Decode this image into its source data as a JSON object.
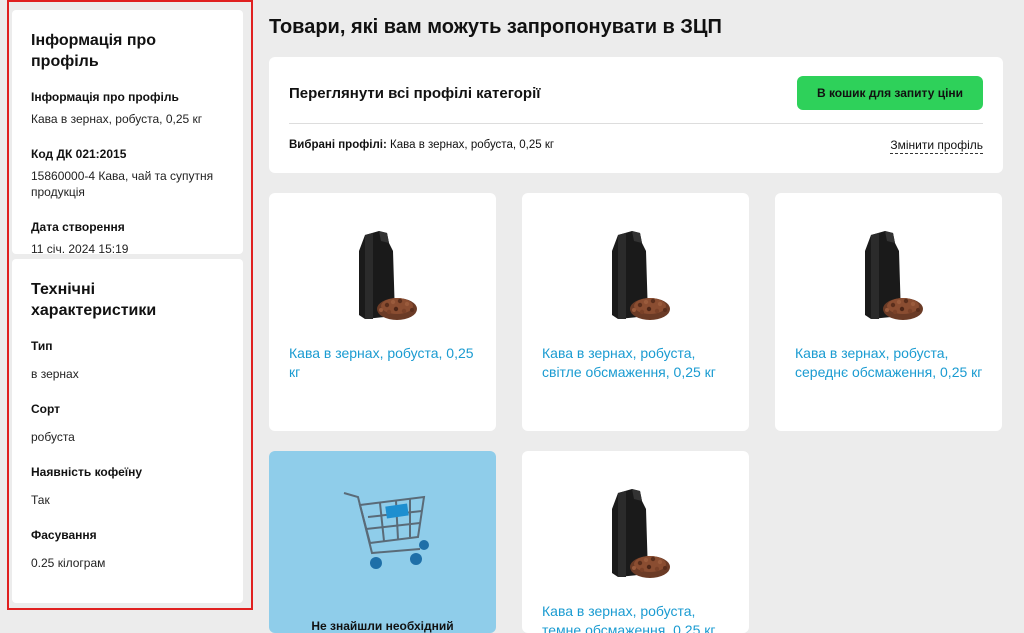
{
  "sidebar": {
    "profile": {
      "heading": "Інформація про профіль",
      "fields": [
        {
          "label": "Інформація про профіль",
          "value": "Кава в зернах, робуста, 0,25 кг"
        },
        {
          "label": "Код ДК 021:2015",
          "value": "15860000-4 Кава, чай та супутня продукція"
        },
        {
          "label": "Дата створення",
          "value": "11 січ. 2024 15:19"
        }
      ]
    },
    "tech": {
      "heading": "Технічні характеристики",
      "fields": [
        {
          "label": "Тип",
          "value": "в зернах"
        },
        {
          "label": "Сорт",
          "value": "робуста"
        },
        {
          "label": "Наявність кофеїну",
          "value": "Так"
        },
        {
          "label": "Фасування",
          "value": "0.25 кілограм"
        }
      ]
    }
  },
  "main": {
    "title": "Товари, які вам можуть запропонувати в ЗЦП",
    "panel": {
      "view_all": "Переглянути всі профілі категорії",
      "cart_button": "В кошик для запиту ціни",
      "selected_label": "Вибрані профілі:",
      "selected_value": " Кава в зернах, робуста, 0,25 кг",
      "change_link": "Змінити профіль"
    },
    "products": [
      {
        "title": "Кава в зернах, робуста, 0,25 кг"
      },
      {
        "title": "Кава в зернах, робуста, світле обсмаження, 0,25 кг"
      },
      {
        "title": "Кава в зернах, робуста, середнє обсмаження, 0,25 кг"
      },
      {
        "title": "Кава в зернах, робуста, темне обсмаження, 0,25 кг"
      }
    ],
    "promo": {
      "text": "Не знайшли необхідний"
    }
  },
  "colors": {
    "accent_green": "#2ed15a",
    "link_blue": "#1a9bd1",
    "promo_bg": "#8fcdea",
    "highlight_red": "#e02020"
  }
}
